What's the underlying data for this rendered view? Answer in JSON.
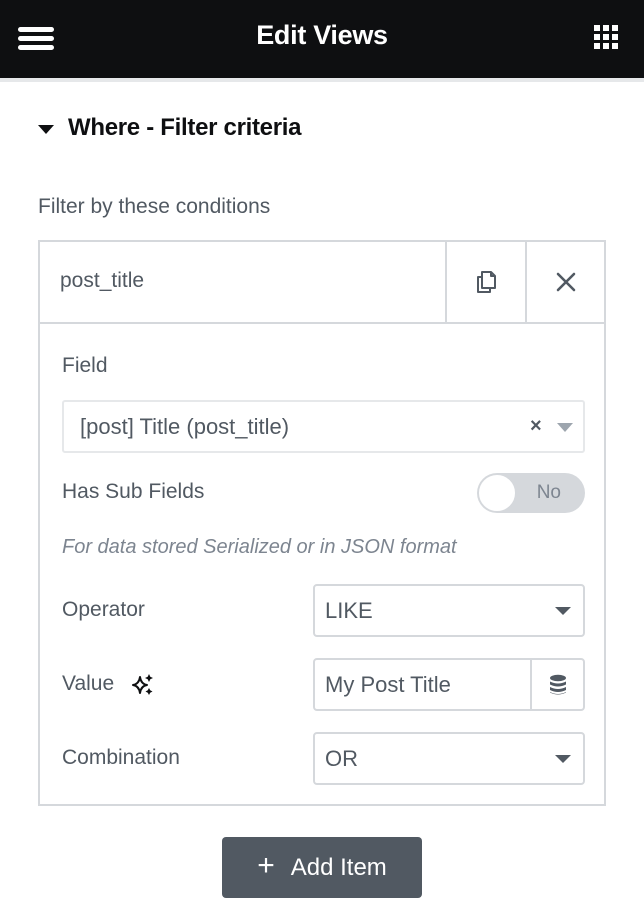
{
  "topbar": {
    "title": "Edit Views",
    "menu_icon": "hamburger-menu-icon",
    "apps_icon": "grid-apps-icon"
  },
  "section": {
    "title": "Where - Filter criteria",
    "expanded": true
  },
  "filter": {
    "label": "Filter by these conditions",
    "items": [
      {
        "title": "post_title",
        "duplicate_icon": "copy-icon",
        "remove_icon": "close-icon",
        "field": {
          "label": "Field",
          "value": "[post] Title (post_title)",
          "clear_glyph": "×"
        },
        "has_sub_fields": {
          "label": "Has Sub Fields",
          "state": "No",
          "enabled": false
        },
        "hint": "For data stored Serialized or in JSON format",
        "operator": {
          "label": "Operator",
          "value": "LIKE"
        },
        "value": {
          "label": "Value",
          "value": "My Post Title",
          "ai_icon": "sparkle-icon",
          "dynamic_icon": "database-icon"
        },
        "combination": {
          "label": "Combination",
          "value": "OR"
        }
      }
    ],
    "add_button": {
      "label": "Add Item",
      "icon": "+"
    }
  },
  "colors": {
    "topbar_bg": "#0e0f11",
    "text": "#515962",
    "border": "#d5d8dc",
    "button_bg": "#515962"
  }
}
